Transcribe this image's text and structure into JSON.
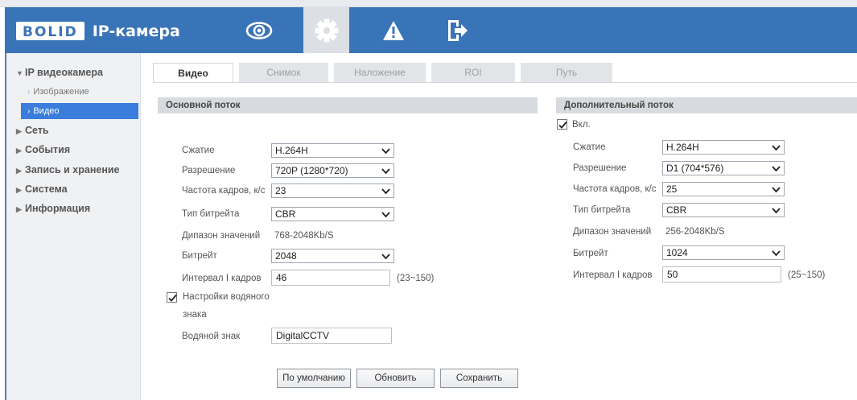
{
  "header": {
    "logo": "BOLID",
    "title": "IP-камера",
    "nav": [
      {
        "icon": "eye-icon",
        "label": "live-view"
      },
      {
        "icon": "gear-icon",
        "label": "settings",
        "active": true
      },
      {
        "icon": "warning-icon",
        "label": "alarm"
      },
      {
        "icon": "logout-icon",
        "label": "logout"
      }
    ],
    "colors": {
      "header_bg": "#3a74b8",
      "accent": "#3a7ddc"
    }
  },
  "sidebar": {
    "section": "IP видеокамера",
    "sub_items": [
      {
        "label": "Изображение",
        "active": false
      },
      {
        "label": "Видео",
        "active": true
      }
    ],
    "items": [
      {
        "label": "Сеть"
      },
      {
        "label": "События"
      },
      {
        "label": "Запись и хранение"
      },
      {
        "label": "Система"
      },
      {
        "label": "Информация"
      }
    ]
  },
  "tabs": [
    {
      "label": "Видео",
      "active": true
    },
    {
      "label": "Снимок",
      "active": false
    },
    {
      "label": "Наложение",
      "active": false
    },
    {
      "label": "ROI",
      "active": false
    },
    {
      "label": "Путь",
      "active": false
    }
  ],
  "main_stream": {
    "title": "Основной поток",
    "compression_label": "Сжатие",
    "compression_value": "H.264H",
    "resolution_label": "Разрешение",
    "resolution_value": "720P (1280*720)",
    "framerate_label": "Частота кадров, к/с",
    "framerate_value": "23",
    "bitrate_type_label": "Тип битрейта",
    "bitrate_type_value": "CBR",
    "range_label": "Дипазон значений",
    "range_value": "768-2048Kb/S",
    "bitrate_label": "Битрейт",
    "bitrate_value": "2048",
    "iframe_label": "Интервал I кадров",
    "iframe_value": "46",
    "iframe_range": "(23~150)",
    "watermark_settings_label_1": "Настройки водяного",
    "watermark_settings_label_2": "знака",
    "watermark_settings_checked": true,
    "watermark_label": "Водяной знак",
    "watermark_value": "DigitalCCTV"
  },
  "sub_stream": {
    "title": "Дополнительный поток",
    "enable_label": "Вкл.",
    "enable_checked": true,
    "compression_label": "Сжатие",
    "compression_value": "H.264H",
    "resolution_label": "Разрешение",
    "resolution_value": "D1 (704*576)",
    "framerate_label": "Частота кадров, к/с",
    "framerate_value": "25",
    "bitrate_type_label": "Тип битрейта",
    "bitrate_type_value": "CBR",
    "range_label": "Дипазон значений",
    "range_value": "256-2048Kb/S",
    "bitrate_label": "Битрейт",
    "bitrate_value": "1024",
    "iframe_label": "Интервал I кадров",
    "iframe_value": "50",
    "iframe_range": "(25~150)"
  },
  "buttons": {
    "default": "По умолчанию",
    "refresh": "Обновить",
    "save": "Сохранить"
  }
}
